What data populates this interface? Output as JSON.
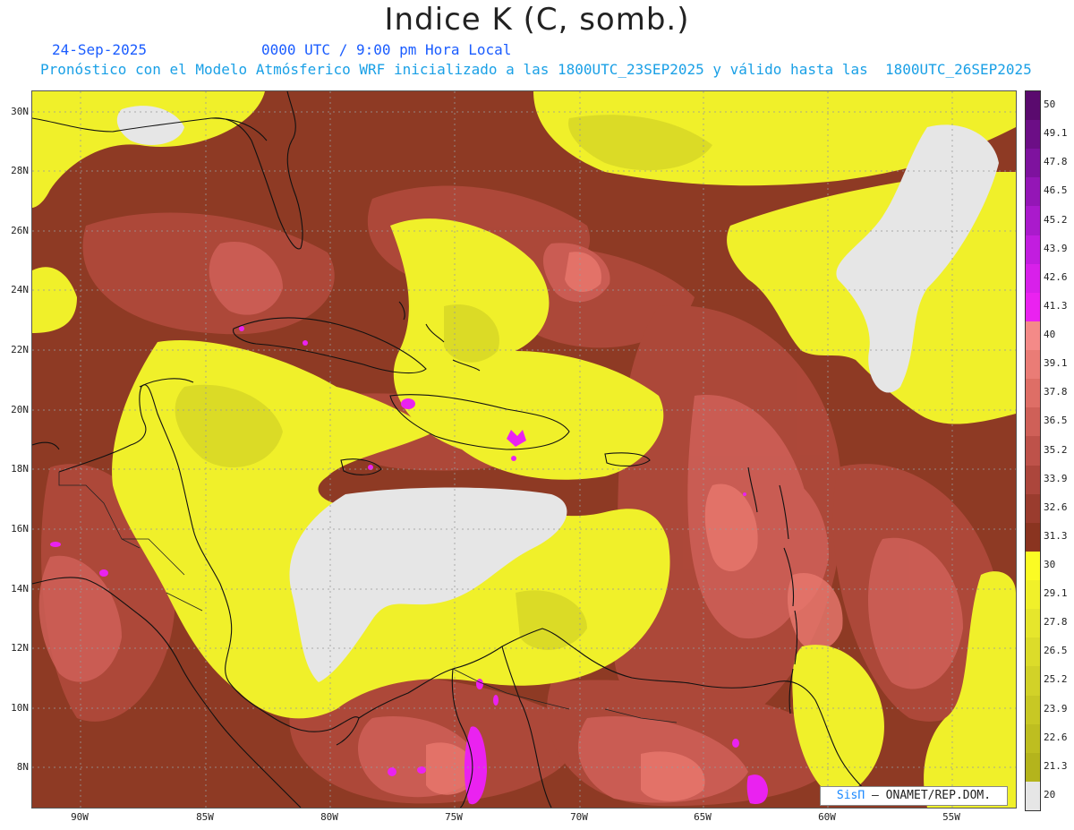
{
  "header": {
    "title": "Indice K (C, somb.)",
    "date": "24-Sep-2025",
    "time": "0000 UTC / 9:00 pm Hora Local",
    "description": "Pronóstico con el Modelo Atmósferico WRF inicializado a las 1800UTC_23SEP2025 y válido hasta las  1800UTC_26SEP2025"
  },
  "map": {
    "lat_labels": [
      "30N",
      "28N",
      "26N",
      "24N",
      "22N",
      "20N",
      "18N",
      "16N",
      "14N",
      "12N",
      "10N",
      "8N"
    ],
    "lon_labels": [
      "90W",
      "85W",
      "80W",
      "75W",
      "70W",
      "65W",
      "60W",
      "55W"
    ],
    "credit_sis": "SisΠ",
    "credit_rest": " – ONAMET/REP.DOM."
  },
  "colorbar": {
    "levels": [
      {
        "label": "50",
        "color": "#5a0a6e"
      },
      {
        "label": "49.1",
        "color": "#6c0e86"
      },
      {
        "label": "47.8",
        "color": "#7e129e"
      },
      {
        "label": "46.5",
        "color": "#9416b6"
      },
      {
        "label": "45.2",
        "color": "#aa1acc"
      },
      {
        "label": "43.9",
        "color": "#c21ddf"
      },
      {
        "label": "42.6",
        "color": "#d820ea"
      },
      {
        "label": "41.3",
        "color": "#ea22f0"
      },
      {
        "label": "40",
        "color": "#f48a88"
      },
      {
        "label": "39.1",
        "color": "#ea7c76"
      },
      {
        "label": "37.8",
        "color": "#de6e66"
      },
      {
        "label": "36.5",
        "color": "#cf6058"
      },
      {
        "label": "35.2",
        "color": "#be524a"
      },
      {
        "label": "33.9",
        "color": "#ac463c"
      },
      {
        "label": "32.6",
        "color": "#9a3c2e"
      },
      {
        "label": "31.3",
        "color": "#8a3420"
      },
      {
        "label": "30",
        "color": "#fbfb24"
      },
      {
        "label": "29.1",
        "color": "#f0f02a"
      },
      {
        "label": "27.8",
        "color": "#e6e62c"
      },
      {
        "label": "26.5",
        "color": "#dcdc2a"
      },
      {
        "label": "25.2",
        "color": "#d2d228"
      },
      {
        "label": "23.9",
        "color": "#c8c824"
      },
      {
        "label": "22.6",
        "color": "#bebe20"
      },
      {
        "label": "21.3",
        "color": "#b4b41c"
      },
      {
        "label": "20",
        "color": "#e6e6e6"
      }
    ]
  },
  "colors": {
    "dry": "#e6e6e6",
    "yellow": "#f0f02a",
    "yellow_dark": "#d4d426",
    "brown": "#8e3a24",
    "brown_mid": "#b04a3c",
    "brown_light": "#cf6058",
    "pink": "#e8786e",
    "magenta": "#ea22f0"
  }
}
